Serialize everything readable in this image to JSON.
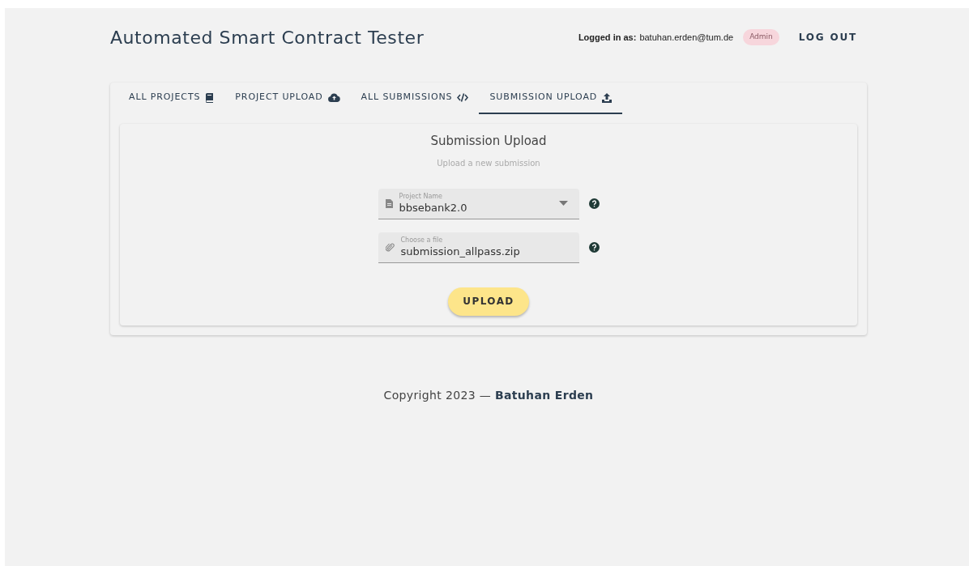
{
  "header": {
    "title": "Automated Smart Contract Tester",
    "login_label": "Logged in as:",
    "user_email": "batuhan.erden@tum.de",
    "role_badge": "Admin",
    "logout": "LOG OUT"
  },
  "tabs": [
    {
      "label": "ALL PROJECTS",
      "kind": "book",
      "selected": false
    },
    {
      "label": "PROJECT UPLOAD",
      "kind": "cloud",
      "selected": false
    },
    {
      "label": "ALL SUBMISSIONS",
      "kind": "code",
      "selected": false
    },
    {
      "label": "SUBMISSION UPLOAD",
      "kind": "upload",
      "selected": true
    }
  ],
  "form": {
    "title": "Submission Upload",
    "subtitle": "Upload a new submission",
    "fields": [
      {
        "kind": "select",
        "label": "Project Name",
        "value": "bbsebank2.0"
      },
      {
        "kind": "file",
        "label": "Choose a file",
        "value": "submission_allpass.zip"
      }
    ],
    "submit": "UPLOAD"
  },
  "footer": {
    "text": "Copyright 2023 — **Batuhan Erden**"
  }
}
